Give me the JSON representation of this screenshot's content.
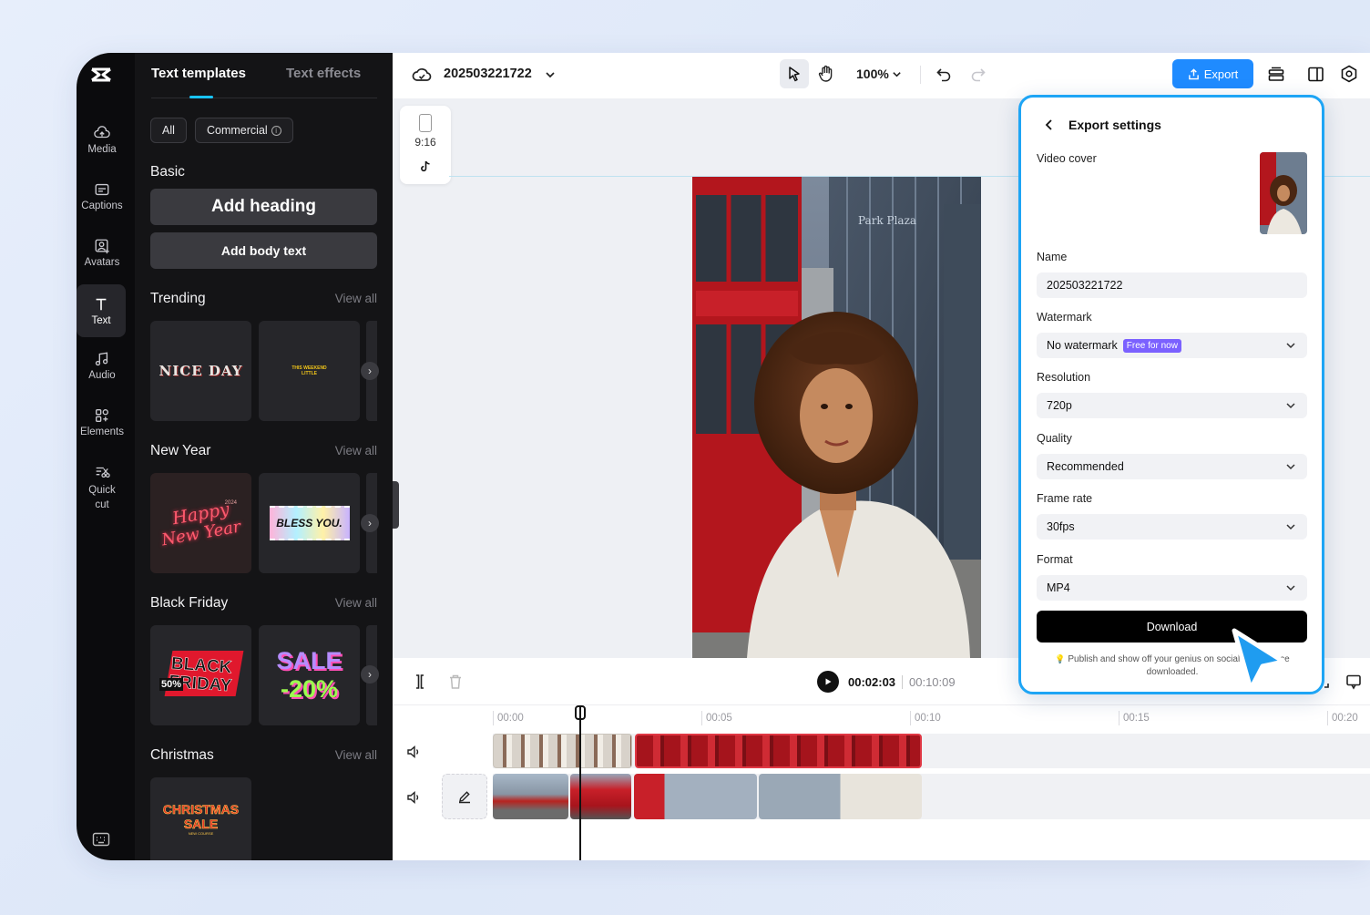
{
  "rail": {
    "items": [
      {
        "label": "Media",
        "icon": "media-cloud-icon"
      },
      {
        "label": "Captions",
        "icon": "captions-icon"
      },
      {
        "label": "Avatars",
        "icon": "avatar-icon"
      },
      {
        "label": "Text",
        "icon": "text-t-icon"
      },
      {
        "label": "Audio",
        "icon": "music-note-icon"
      },
      {
        "label": "Elements",
        "icon": "elements-grid-icon"
      },
      {
        "label": "Quick cut",
        "icon": "quick-cut-icon"
      }
    ]
  },
  "panel": {
    "tabs": [
      "Text templates",
      "Text effects"
    ],
    "filters": [
      "All",
      "Commercial"
    ],
    "basic_title": "Basic",
    "add_heading": "Add heading",
    "add_body": "Add body text",
    "view_all": "View all",
    "sections": [
      {
        "title": "Trending",
        "tiles": [
          "NICE DAY",
          "THIS WEEKEND LITTLE"
        ]
      },
      {
        "title": "New Year",
        "tiles": [
          "Happy New Year",
          "BLESS YOU."
        ]
      },
      {
        "title": "Black Friday",
        "tiles": [
          "BLACK FRIDAY",
          "SALE -20%"
        ]
      },
      {
        "title": "Christmas",
        "tiles": [
          "CHRISTMAS SALE"
        ]
      }
    ],
    "tile_texts": {
      "nice_day": "NICE DAY",
      "happy": "Happy",
      "new_year": "New Year",
      "year_2024": "2024",
      "bless": "BLESS YOU.",
      "black": "BLACK",
      "friday": "FRIDAY",
      "pct": "50%",
      "sale": "SALE",
      "minus20": "-20%",
      "christmas": "CHRISTMAS",
      "xsale": "SALE",
      "new_collection": "NEW COURSE"
    }
  },
  "topbar": {
    "project_name": "202503221722",
    "zoom": "100%",
    "export_label": "Export"
  },
  "canvas": {
    "ratio_label": "9:16",
    "building_sign": "Park Plaza"
  },
  "playback": {
    "current_time": "00:02:03",
    "total_time": "00:10:09"
  },
  "timeline": {
    "ticks": [
      "00:00",
      "00:05",
      "00:10",
      "00:15",
      "00:20"
    ]
  },
  "export_settings": {
    "title": "Export settings",
    "video_cover_label": "Video cover",
    "name_label": "Name",
    "name_value": "202503221722",
    "watermark_label": "Watermark",
    "watermark_value": "No watermark",
    "watermark_badge": "Free for now",
    "resolution_label": "Resolution",
    "resolution_value": "720p",
    "quality_label": "Quality",
    "quality_value": "Recommended",
    "frame_rate_label": "Frame rate",
    "frame_rate_value": "30fps",
    "format_label": "Format",
    "format_value": "MP4",
    "download_label": "Download",
    "note_icon": "💡",
    "note_text": "Publish and show off your genius on social media once downloaded."
  },
  "colors": {
    "accent": "#1f8bff",
    "modal_border": "#1ea5f5",
    "badge": "#7b61ff",
    "rail_bg": "#0b0b0d",
    "panel_bg": "#141416"
  }
}
